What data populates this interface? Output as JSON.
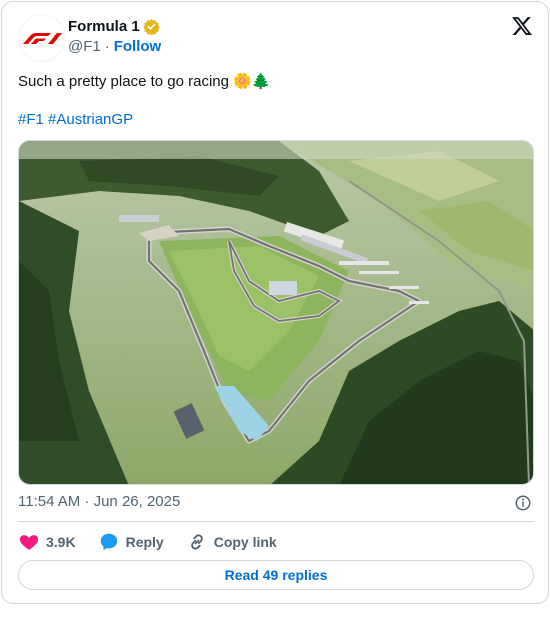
{
  "author": {
    "name": "Formula 1",
    "handle": "@F1",
    "separator": "·",
    "follow_label": "Follow",
    "avatar_icon": "f1-logo-icon",
    "verified_color": "#e2b719"
  },
  "tweet": {
    "text": "Such a pretty place to go racing 🌼🌲",
    "hashtags": [
      "#F1",
      "#AustrianGP"
    ],
    "media": {
      "description_icon": "photo"
    },
    "timestamp": "11:54 AM · Jun 26, 2025"
  },
  "actions": {
    "likes_count": "3.9K",
    "reply_label": "Reply",
    "copy_label": "Copy link"
  },
  "read_replies_label": "Read 49 replies",
  "colors": {
    "accent": "#006fd6",
    "heart": "#f91880",
    "reply_bubble": "#1d9bf0",
    "f1_red": "#e10600"
  }
}
